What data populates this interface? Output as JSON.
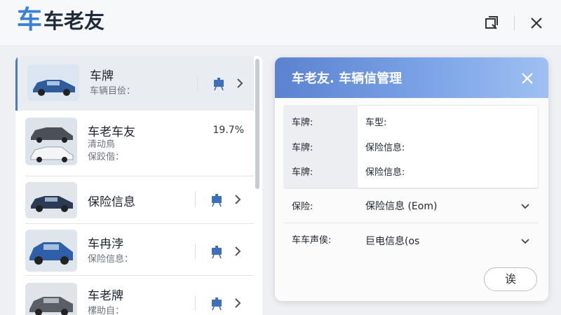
{
  "app": {
    "logo_char": "车",
    "title": "车老友"
  },
  "titlebar": {
    "restore_icon": "window-restore-icon",
    "close_icon": "close-icon"
  },
  "list": {
    "items": [
      {
        "title": "车牌",
        "sub1": "车辆目侩：",
        "sub2": "",
        "pct": "",
        "selected": true
      },
      {
        "title": "车老车友",
        "sub1": "清动鳥",
        "sub2": "保跤偕：",
        "pct": "19.7%",
        "selected": false
      },
      {
        "title": "保险信息",
        "sub1": "",
        "sub2": "",
        "pct": "",
        "selected": false
      },
      {
        "title": "车冉浡",
        "sub1": "保险信息：",
        "sub2": "",
        "pct": "",
        "selected": false
      },
      {
        "title": "车老牌",
        "sub1": "樏助自：",
        "sub2": "",
        "pct": "",
        "selected": false
      }
    ]
  },
  "dialog": {
    "title": "车老友. 车辆信管理",
    "labels": {
      "plate1": "车牌:",
      "plate2": "车牌:",
      "plate3": "车牌:",
      "model": "车型:",
      "insurance_info1": "保险信息:",
      "insurance_info2": "保险信息:",
      "insurance": "保险:",
      "car_field": "车车声俟:"
    },
    "insurance_select": "保险信息 (Eom)",
    "car_field_select": "巨电信息(os",
    "ok_label": "诶"
  },
  "colors": {
    "accent": "#3b7fd6",
    "header_gradient_start": "#5a82cf",
    "header_gradient_end": "#9ec0f2"
  }
}
